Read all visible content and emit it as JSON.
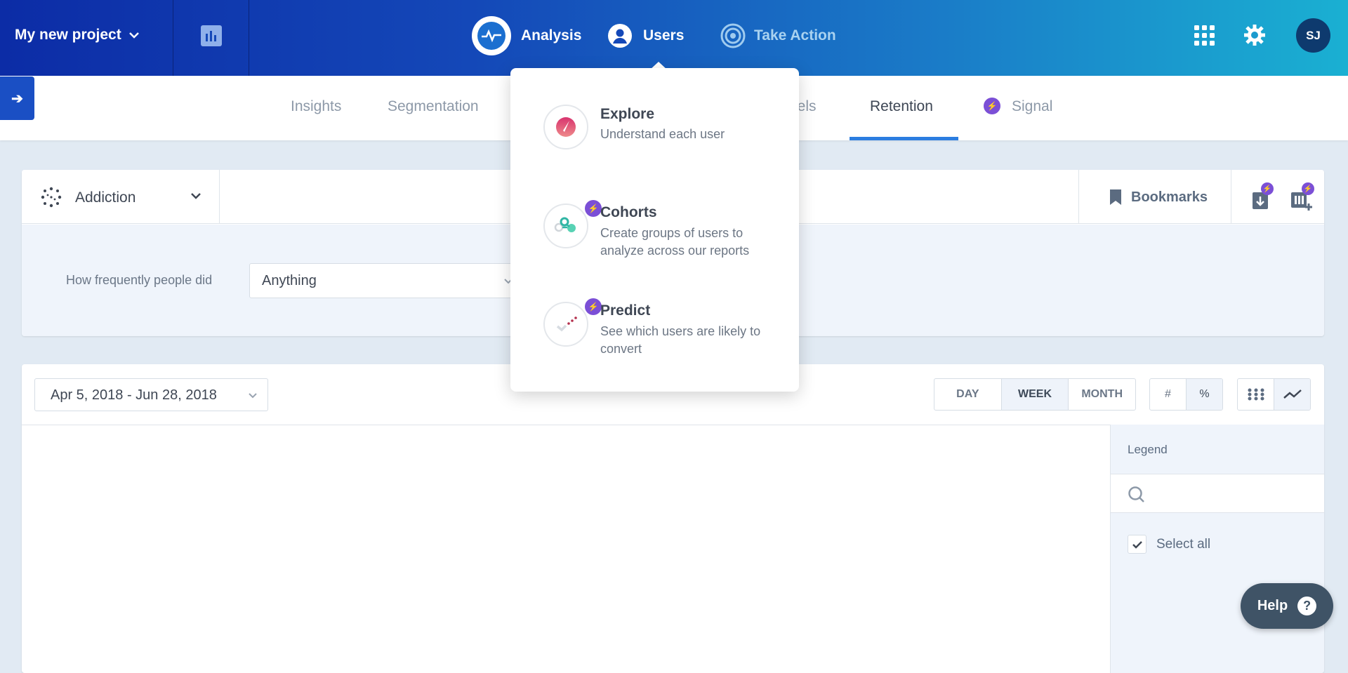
{
  "header": {
    "project": "My new project",
    "nav": [
      {
        "label": "Analysis",
        "icon": "analysis-pulse-icon"
      },
      {
        "label": "Users",
        "icon": "user-icon"
      },
      {
        "label": "Take Action",
        "icon": "target-icon"
      }
    ],
    "avatar": "SJ"
  },
  "tabs": [
    {
      "label": "Insights"
    },
    {
      "label": "Segmentation"
    },
    {
      "label": "nels"
    },
    {
      "label": "Retention",
      "active": true
    },
    {
      "label": "Signal"
    }
  ],
  "query": {
    "report": "Addiction",
    "bookmarks": "Bookmarks",
    "frequency_label": "How frequently people did",
    "event": "Anything"
  },
  "toolbar": {
    "date_range": "Apr 5, 2018 - Jun 28, 2018",
    "intervals": [
      "DAY",
      "WEEK",
      "MONTH"
    ],
    "active_interval": "WEEK",
    "units": [
      "#",
      "%"
    ],
    "active_unit": "%"
  },
  "legend": {
    "title": "Legend",
    "search_placeholder": "",
    "select_all": "Select all",
    "select_all_checked": true
  },
  "help": "Help",
  "users_menu": [
    {
      "title": "Explore",
      "subtitle": "Understand each user"
    },
    {
      "title": "Cohorts",
      "subtitle": "Create groups of users to analyze across our reports"
    },
    {
      "title": "Predict",
      "subtitle": "See which users are likely to convert"
    }
  ],
  "colors": {
    "accent": "#2b7de0",
    "signal_badge": "#7b4fd6",
    "help_bg": "#3f5366"
  }
}
